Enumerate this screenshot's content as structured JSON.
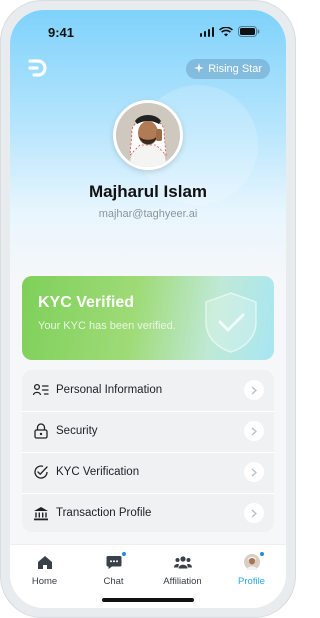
{
  "status_bar": {
    "time": "9:41"
  },
  "header": {
    "badge_label": "Rising Star"
  },
  "profile": {
    "name": "Majharul Islam",
    "email": "majhar@taghyeer.ai"
  },
  "kyc": {
    "title": "KYC Verified",
    "subtitle": "Your KYC has been verified."
  },
  "menu": {
    "items": [
      {
        "label": "Personal Information",
        "icon": "user-list-icon"
      },
      {
        "label": "Security",
        "icon": "lock-icon"
      },
      {
        "label": "KYC Verification",
        "icon": "verified-badge-icon"
      },
      {
        "label": "Transaction Profile",
        "icon": "bank-icon"
      }
    ]
  },
  "tabbar": {
    "tabs": [
      {
        "label": "Home",
        "icon": "home-icon"
      },
      {
        "label": "Chat",
        "icon": "chat-icon"
      },
      {
        "label": "Affiliation",
        "icon": "users-icon"
      },
      {
        "label": "Profile",
        "icon": "avatar-icon"
      }
    ],
    "active": "Profile"
  },
  "colors": {
    "accent": "#2aa7e0",
    "kyc_green": "#7ed05a",
    "sky": "#7fd2fb"
  }
}
